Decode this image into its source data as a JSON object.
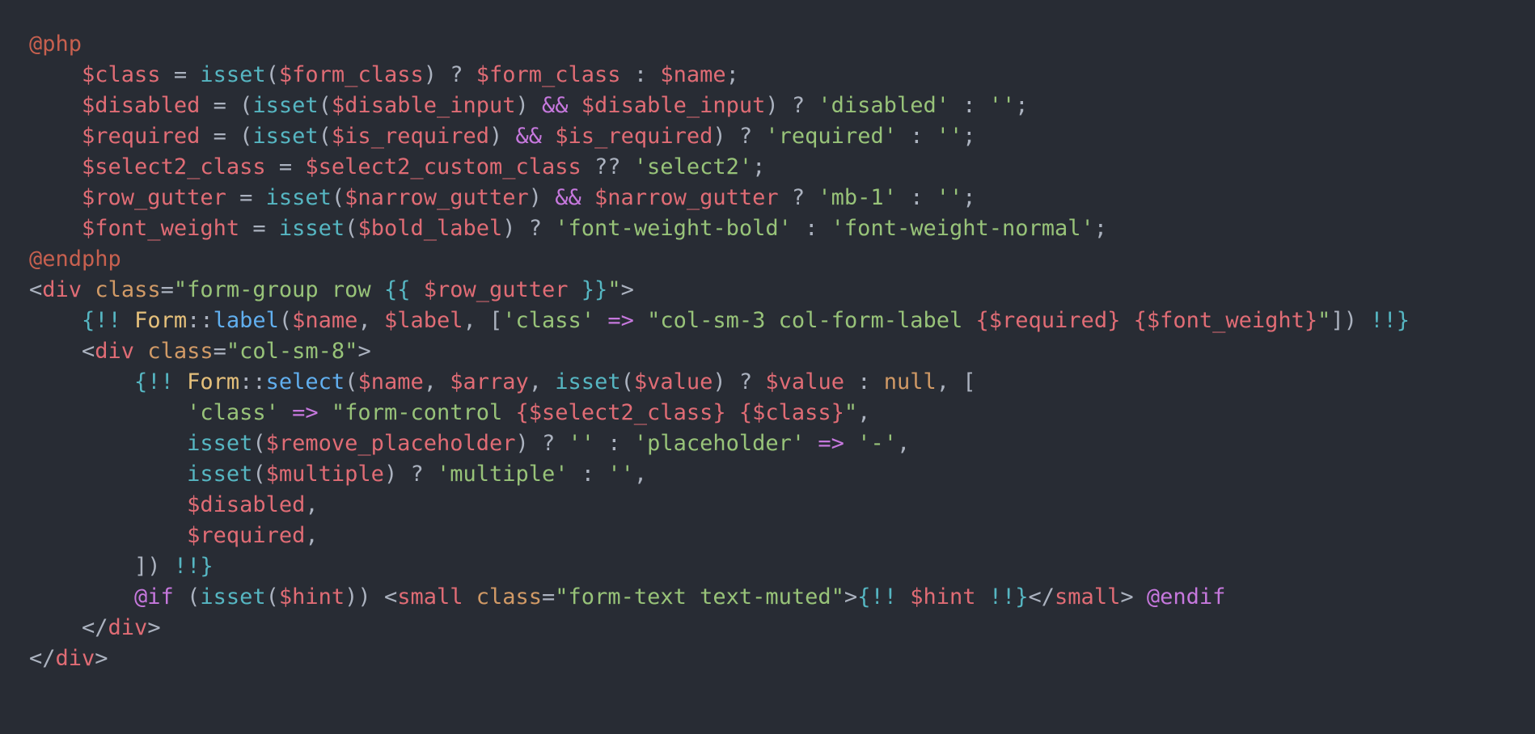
{
  "colors": {
    "background": "#282c34",
    "plain": "#abb2bf",
    "variable": "#e06c75",
    "function": "#56b6c2",
    "string": "#98c379",
    "keyword": "#c678dd",
    "directive": "#c7604f",
    "tag": "#e06c75",
    "attribute": "#d19a66",
    "constant": "#d19a66",
    "class": "#e5c07b",
    "method": "#61afef",
    "echo": "#56b6c2"
  },
  "lines": [
    [
      [
        "dir",
        "@php"
      ]
    ],
    [
      [
        "op",
        "    "
      ],
      [
        "var",
        "$class"
      ],
      [
        "op",
        " = "
      ],
      [
        "fn",
        "isset"
      ],
      [
        "op",
        "("
      ],
      [
        "var",
        "$form_class"
      ],
      [
        "op",
        ") ? "
      ],
      [
        "var",
        "$form_class"
      ],
      [
        "op",
        " : "
      ],
      [
        "var",
        "$name"
      ],
      [
        "op",
        ";"
      ]
    ],
    [
      [
        "op",
        "    "
      ],
      [
        "var",
        "$disabled"
      ],
      [
        "op",
        " = ("
      ],
      [
        "fn",
        "isset"
      ],
      [
        "op",
        "("
      ],
      [
        "var",
        "$disable_input"
      ],
      [
        "op",
        ") "
      ],
      [
        "kw",
        "&&"
      ],
      [
        "op",
        " "
      ],
      [
        "var",
        "$disable_input"
      ],
      [
        "op",
        ") ? "
      ],
      [
        "str",
        "'disabled'"
      ],
      [
        "op",
        " : "
      ],
      [
        "str",
        "''"
      ],
      [
        "op",
        ";"
      ]
    ],
    [
      [
        "op",
        "    "
      ],
      [
        "var",
        "$required"
      ],
      [
        "op",
        " = ("
      ],
      [
        "fn",
        "isset"
      ],
      [
        "op",
        "("
      ],
      [
        "var",
        "$is_required"
      ],
      [
        "op",
        ") "
      ],
      [
        "kw",
        "&&"
      ],
      [
        "op",
        " "
      ],
      [
        "var",
        "$is_required"
      ],
      [
        "op",
        ") ? "
      ],
      [
        "str",
        "'required'"
      ],
      [
        "op",
        " : "
      ],
      [
        "str",
        "''"
      ],
      [
        "op",
        ";"
      ]
    ],
    [
      [
        "op",
        "    "
      ],
      [
        "var",
        "$select2_class"
      ],
      [
        "op",
        " = "
      ],
      [
        "var",
        "$select2_custom_class"
      ],
      [
        "op",
        " ?? "
      ],
      [
        "str",
        "'select2'"
      ],
      [
        "op",
        ";"
      ]
    ],
    [
      [
        "op",
        "    "
      ],
      [
        "var",
        "$row_gutter"
      ],
      [
        "op",
        " = "
      ],
      [
        "fn",
        "isset"
      ],
      [
        "op",
        "("
      ],
      [
        "var",
        "$narrow_gutter"
      ],
      [
        "op",
        ") "
      ],
      [
        "kw",
        "&&"
      ],
      [
        "op",
        " "
      ],
      [
        "var",
        "$narrow_gutter"
      ],
      [
        "op",
        " ? "
      ],
      [
        "str",
        "'mb-1'"
      ],
      [
        "op",
        " : "
      ],
      [
        "str",
        "''"
      ],
      [
        "op",
        ";"
      ]
    ],
    [
      [
        "op",
        "    "
      ],
      [
        "var",
        "$font_weight"
      ],
      [
        "op",
        " = "
      ],
      [
        "fn",
        "isset"
      ],
      [
        "op",
        "("
      ],
      [
        "var",
        "$bold_label"
      ],
      [
        "op",
        ") ? "
      ],
      [
        "str",
        "'font-weight-bold'"
      ],
      [
        "op",
        " : "
      ],
      [
        "str",
        "'font-weight-normal'"
      ],
      [
        "op",
        ";"
      ]
    ],
    [
      [
        "dir",
        "@endphp"
      ]
    ],
    [
      [
        "op",
        "<"
      ],
      [
        "tag",
        "div"
      ],
      [
        "op",
        " "
      ],
      [
        "attr",
        "class"
      ],
      [
        "op",
        "="
      ],
      [
        "str",
        "\"form-group row "
      ],
      [
        "echo",
        "{{ "
      ],
      [
        "var",
        "$row_gutter"
      ],
      [
        "echo",
        " }}"
      ],
      [
        "str",
        "\""
      ],
      [
        "op",
        ">"
      ]
    ],
    [
      [
        "op",
        "    "
      ],
      [
        "echo",
        "{!! "
      ],
      [
        "cls",
        "Form"
      ],
      [
        "op",
        "::"
      ],
      [
        "meth",
        "label"
      ],
      [
        "op",
        "("
      ],
      [
        "var",
        "$name"
      ],
      [
        "op",
        ", "
      ],
      [
        "var",
        "$label"
      ],
      [
        "op",
        ", ["
      ],
      [
        "str",
        "'class'"
      ],
      [
        "op",
        " "
      ],
      [
        "kw",
        "=>"
      ],
      [
        "op",
        " "
      ],
      [
        "str",
        "\"col-sm-3 col-form-label "
      ],
      [
        "var",
        "{$required}"
      ],
      [
        "str",
        " "
      ],
      [
        "var",
        "{$font_weight}"
      ],
      [
        "str",
        "\""
      ],
      [
        "op",
        "]) "
      ],
      [
        "echo",
        "!!}"
      ]
    ],
    [
      [
        "op",
        "    <"
      ],
      [
        "tag",
        "div"
      ],
      [
        "op",
        " "
      ],
      [
        "attr",
        "class"
      ],
      [
        "op",
        "="
      ],
      [
        "str",
        "\"col-sm-8\""
      ],
      [
        "op",
        ">"
      ]
    ],
    [
      [
        "op",
        "        "
      ],
      [
        "echo",
        "{!! "
      ],
      [
        "cls",
        "Form"
      ],
      [
        "op",
        "::"
      ],
      [
        "meth",
        "select"
      ],
      [
        "op",
        "("
      ],
      [
        "var",
        "$name"
      ],
      [
        "op",
        ", "
      ],
      [
        "var",
        "$array"
      ],
      [
        "op",
        ", "
      ],
      [
        "fn",
        "isset"
      ],
      [
        "op",
        "("
      ],
      [
        "var",
        "$value"
      ],
      [
        "op",
        ") ? "
      ],
      [
        "var",
        "$value"
      ],
      [
        "op",
        " : "
      ],
      [
        "const",
        "null"
      ],
      [
        "op",
        ", ["
      ]
    ],
    [
      [
        "op",
        "            "
      ],
      [
        "str",
        "'class'"
      ],
      [
        "op",
        " "
      ],
      [
        "kw",
        "=>"
      ],
      [
        "op",
        " "
      ],
      [
        "str",
        "\"form-control "
      ],
      [
        "var",
        "{$select2_class}"
      ],
      [
        "str",
        " "
      ],
      [
        "var",
        "{$class}"
      ],
      [
        "str",
        "\""
      ],
      [
        "op",
        ","
      ]
    ],
    [
      [
        "op",
        "            "
      ],
      [
        "fn",
        "isset"
      ],
      [
        "op",
        "("
      ],
      [
        "var",
        "$remove_placeholder"
      ],
      [
        "op",
        ") ? "
      ],
      [
        "str",
        "''"
      ],
      [
        "op",
        " : "
      ],
      [
        "str",
        "'placeholder'"
      ],
      [
        "op",
        " "
      ],
      [
        "kw",
        "=>"
      ],
      [
        "op",
        " "
      ],
      [
        "str",
        "'-'"
      ],
      [
        "op",
        ","
      ]
    ],
    [
      [
        "op",
        "            "
      ],
      [
        "fn",
        "isset"
      ],
      [
        "op",
        "("
      ],
      [
        "var",
        "$multiple"
      ],
      [
        "op",
        ") ? "
      ],
      [
        "str",
        "'multiple'"
      ],
      [
        "op",
        " : "
      ],
      [
        "str",
        "''"
      ],
      [
        "op",
        ","
      ]
    ],
    [
      [
        "op",
        "            "
      ],
      [
        "var",
        "$disabled"
      ],
      [
        "op",
        ","
      ]
    ],
    [
      [
        "op",
        "            "
      ],
      [
        "var",
        "$required"
      ],
      [
        "op",
        ","
      ]
    ],
    [
      [
        "op",
        "        ]) "
      ],
      [
        "echo",
        "!!}"
      ]
    ],
    [
      [
        "op",
        "        "
      ],
      [
        "kw",
        "@if"
      ],
      [
        "op",
        " ("
      ],
      [
        "fn",
        "isset"
      ],
      [
        "op",
        "("
      ],
      [
        "var",
        "$hint"
      ],
      [
        "op",
        ")) <"
      ],
      [
        "tag",
        "small"
      ],
      [
        "op",
        " "
      ],
      [
        "attr",
        "class"
      ],
      [
        "op",
        "="
      ],
      [
        "str",
        "\"form-text text-muted\""
      ],
      [
        "op",
        ">"
      ],
      [
        "echo",
        "{!! "
      ],
      [
        "var",
        "$hint"
      ],
      [
        "echo",
        " !!}"
      ],
      [
        "op",
        "</"
      ],
      [
        "tag",
        "small"
      ],
      [
        "op",
        "> "
      ],
      [
        "kw",
        "@endif"
      ]
    ],
    [
      [
        "op",
        "    </"
      ],
      [
        "tag",
        "div"
      ],
      [
        "op",
        ">"
      ]
    ],
    [
      [
        "op",
        "</"
      ],
      [
        "tag",
        "div"
      ],
      [
        "op",
        ">"
      ]
    ]
  ]
}
